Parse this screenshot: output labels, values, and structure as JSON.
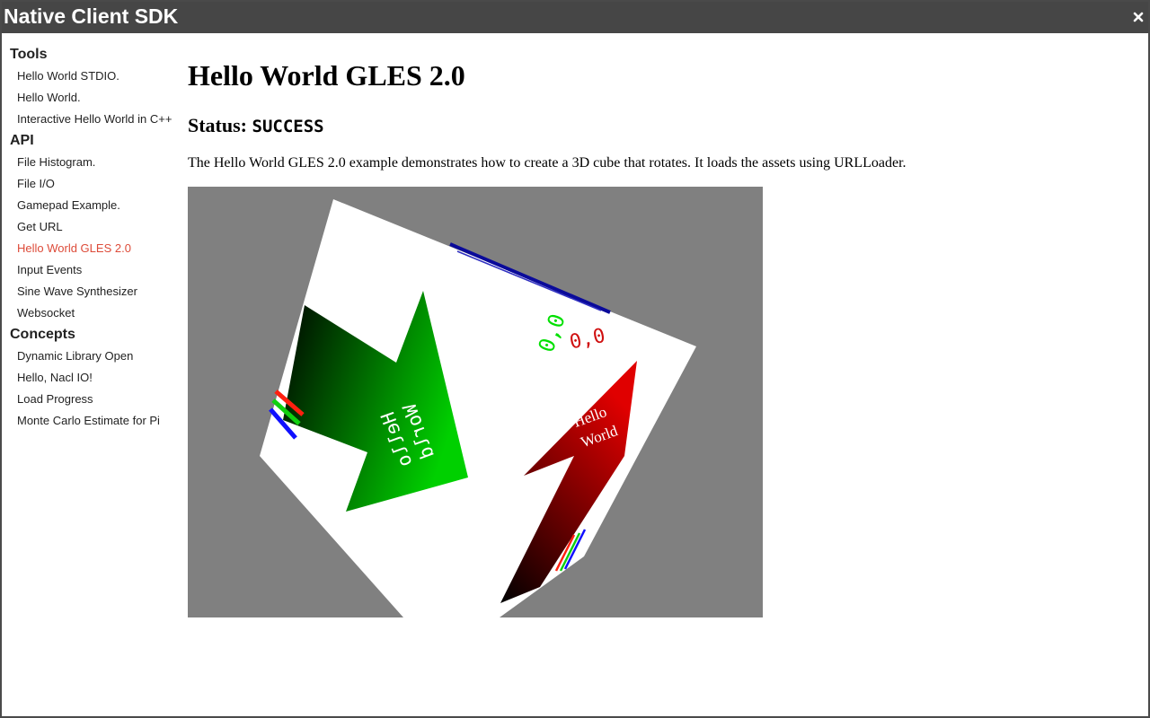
{
  "window": {
    "title": "Native Client SDK",
    "close_glyph": "×"
  },
  "sidebar": {
    "sections": [
      {
        "heading": "Tools",
        "items": [
          "Hello World STDIO.",
          "Hello World.",
          "Interactive Hello World in C++"
        ]
      },
      {
        "heading": "API",
        "items": [
          "File Histogram.",
          "File I/O",
          "Gamepad Example.",
          "Get URL",
          "Hello World GLES 2.0",
          "Input Events",
          "Sine Wave Synthesizer",
          "Websocket"
        ]
      },
      {
        "heading": "Concepts",
        "items": [
          "Dynamic Library Open",
          "Hello, Nacl IO!",
          "Load Progress",
          "Monte Carlo Estimate for Pi"
        ]
      }
    ],
    "active_item": "Hello World GLES 2.0",
    "active_color": "#dd4b39"
  },
  "main": {
    "title": "Hello World GLES 2.0",
    "status_label": "Status: ",
    "status_value": "SUCCESS",
    "description": "The Hello World GLES 2.0 example demonstrates how to create a 3D cube that rotates. It loads the assets using URLLoader.",
    "canvas": {
      "background": "#808080",
      "face_text_1": "Hello",
      "face_text_2": "World",
      "corner_label_green": "0,0",
      "corner_label_red": "0,0"
    }
  }
}
